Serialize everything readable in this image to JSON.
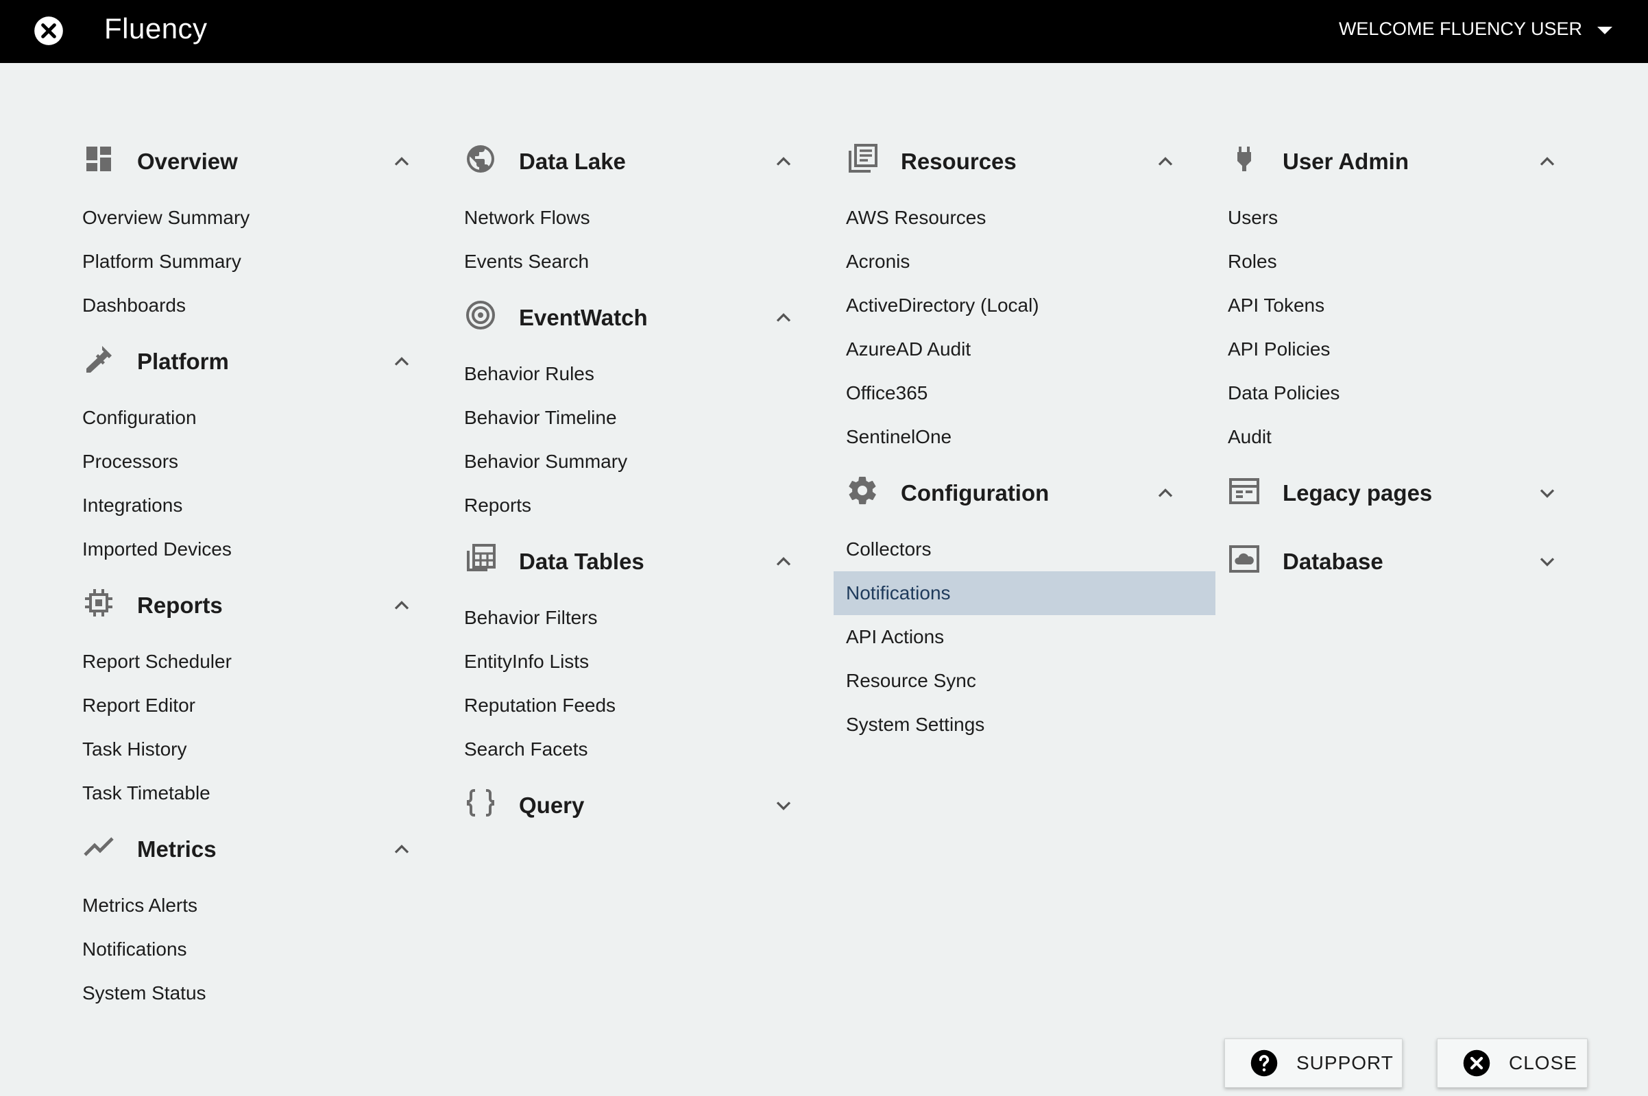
{
  "topbar": {
    "title": "Fluency",
    "welcome": "WELCOME FLUENCY USER"
  },
  "columns": [
    {
      "sections": [
        {
          "title": "Overview",
          "icon": "dashboard-icon",
          "expanded": true,
          "items": [
            "Overview Summary",
            "Platform Summary",
            "Dashboards"
          ]
        },
        {
          "title": "Platform",
          "icon": "wrench-icon",
          "expanded": true,
          "items": [
            "Configuration",
            "Processors",
            "Integrations",
            "Imported Devices"
          ]
        },
        {
          "title": "Reports",
          "icon": "chip-icon",
          "expanded": true,
          "items": [
            "Report Scheduler",
            "Report Editor",
            "Task History",
            "Task Timetable"
          ]
        },
        {
          "title": "Metrics",
          "icon": "trend-icon",
          "expanded": true,
          "items": [
            "Metrics Alerts",
            "Notifications",
            "System Status"
          ]
        }
      ]
    },
    {
      "sections": [
        {
          "title": "Data Lake",
          "icon": "globe-icon",
          "expanded": true,
          "items": [
            "Network Flows",
            "Events Search"
          ]
        },
        {
          "title": "EventWatch",
          "icon": "target-icon",
          "expanded": true,
          "items": [
            "Behavior Rules",
            "Behavior Timeline",
            "Behavior Summary",
            "Reports"
          ]
        },
        {
          "title": "Data Tables",
          "icon": "table-icon",
          "expanded": true,
          "items": [
            "Behavior Filters",
            "EntityInfo Lists",
            "Reputation Feeds",
            "Search Facets"
          ]
        },
        {
          "title": "Query",
          "icon": "braces-icon",
          "expanded": false,
          "items": []
        }
      ]
    },
    {
      "sections": [
        {
          "title": "Resources",
          "icon": "library-icon",
          "expanded": true,
          "items": [
            "AWS Resources",
            "Acronis",
            "ActiveDirectory (Local)",
            "AzureAD Audit",
            "Office365",
            "SentinelOne"
          ]
        },
        {
          "title": "Configuration",
          "icon": "gear-icon",
          "expanded": true,
          "items": [
            "Collectors",
            "Notifications",
            "API Actions",
            "Resource Sync",
            "System Settings"
          ],
          "selected": "Notifications"
        }
      ]
    },
    {
      "sections": [
        {
          "title": "User Admin",
          "icon": "plug-icon",
          "expanded": true,
          "items": [
            "Users",
            "Roles",
            "API Tokens",
            "API Policies",
            "Data Policies",
            "Audit"
          ]
        },
        {
          "title": "Legacy pages",
          "icon": "calendar-icon",
          "expanded": false,
          "items": []
        },
        {
          "title": "Database",
          "icon": "cloud-box-icon",
          "expanded": false,
          "items": []
        }
      ]
    }
  ],
  "footer": {
    "support_label": "SUPPORT",
    "close_label": "CLOSE"
  },
  "colors": {
    "topbar": "#000000",
    "background": "#eef1f1",
    "selected": "#c6d2dd",
    "icon": "#6b6b6b"
  }
}
